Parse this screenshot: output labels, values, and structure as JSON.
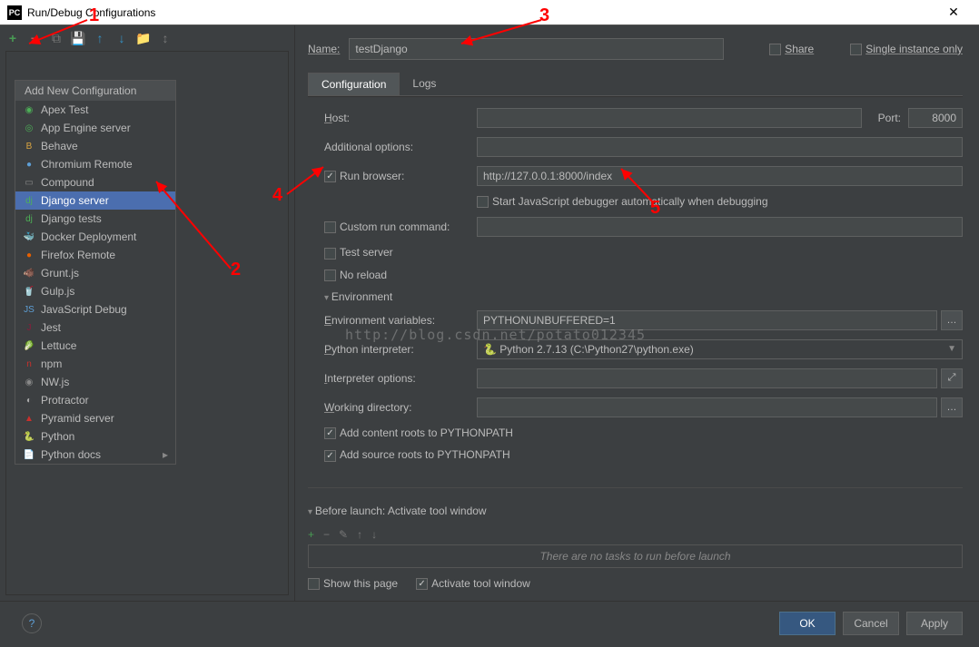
{
  "window": {
    "title": "Run/Debug Configurations"
  },
  "toolbar": {},
  "popup": {
    "header": "Add New Configuration",
    "items": [
      {
        "label": "Apex Test",
        "color": "#4db057",
        "glyph": "◉"
      },
      {
        "label": "App Engine server",
        "color": "#4db057",
        "glyph": "◎"
      },
      {
        "label": "Behave",
        "color": "#d9a441",
        "glyph": "B"
      },
      {
        "label": "Chromium Remote",
        "color": "#5e9fd6",
        "glyph": "●"
      },
      {
        "label": "Compound",
        "color": "#888",
        "glyph": "▭"
      },
      {
        "label": "Django server",
        "color": "#4db057",
        "glyph": "dj",
        "selected": true
      },
      {
        "label": "Django tests",
        "color": "#4db057",
        "glyph": "dj"
      },
      {
        "label": "Docker Deployment",
        "color": "#5e9fd6",
        "glyph": "🐳"
      },
      {
        "label": "Firefox Remote",
        "color": "#e66000",
        "glyph": "●"
      },
      {
        "label": "Grunt.js",
        "color": "#d9a441",
        "glyph": "🐗"
      },
      {
        "label": "Gulp.js",
        "color": "#c9302c",
        "glyph": "🥤"
      },
      {
        "label": "JavaScript Debug",
        "color": "#5e9fd6",
        "glyph": "JS"
      },
      {
        "label": "Jest",
        "color": "#8a1c3b",
        "glyph": "J"
      },
      {
        "label": "Lettuce",
        "color": "#4db057",
        "glyph": "🥬"
      },
      {
        "label": "npm",
        "color": "#c9302c",
        "glyph": "n"
      },
      {
        "label": "NW.js",
        "color": "#888",
        "glyph": "◉"
      },
      {
        "label": "Protractor",
        "color": "#a8a8a8",
        "glyph": "◐"
      },
      {
        "label": "Pyramid server",
        "color": "#c9302c",
        "glyph": "▲"
      },
      {
        "label": "Python",
        "color": "#3776ab",
        "glyph": "🐍"
      },
      {
        "label": "Python docs",
        "color": "#888",
        "glyph": "📄",
        "expandable": true
      }
    ]
  },
  "name_label": "Name:",
  "name_value": "testDjango",
  "share_label": "Share",
  "single_instance_label": "Single instance only",
  "tabs": {
    "config": "Configuration",
    "logs": "Logs"
  },
  "form": {
    "host_label": "Host:",
    "port_label": "Port:",
    "port_value": "8000",
    "addl_opts_label": "Additional options:",
    "run_browser_label": "Run browser:",
    "run_browser_value": "http://127.0.0.1:8000/index",
    "start_js_label": "Start JavaScript debugger automatically when debugging",
    "custom_cmd_label": "Custom run command:",
    "test_server_label": "Test server",
    "no_reload_label": "No reload",
    "env_header": "Environment",
    "env_vars_label": "Environment variables:",
    "env_vars_value": "PYTHONUNBUFFERED=1",
    "py_interp_label": "Python interpreter:",
    "py_interp_value": "Python 2.7.13 (C:\\Python27\\python.exe)",
    "interp_opts_label": "Interpreter options:",
    "work_dir_label": "Working directory:",
    "add_content_label": "Add content roots to PYTHONPATH",
    "add_source_label": "Add source roots to PYTHONPATH"
  },
  "before_launch": {
    "header": "Before launch: Activate tool window",
    "empty": "There are no tasks to run before launch",
    "show_page": "Show this page",
    "activate": "Activate tool window"
  },
  "buttons": {
    "ok": "OK",
    "cancel": "Cancel",
    "apply": "Apply"
  },
  "annotations": {
    "n1": "1",
    "n2": "2",
    "n3": "3",
    "n4": "4",
    "n5": "5"
  },
  "watermark": "http://blog.csdn.net/potato012345"
}
